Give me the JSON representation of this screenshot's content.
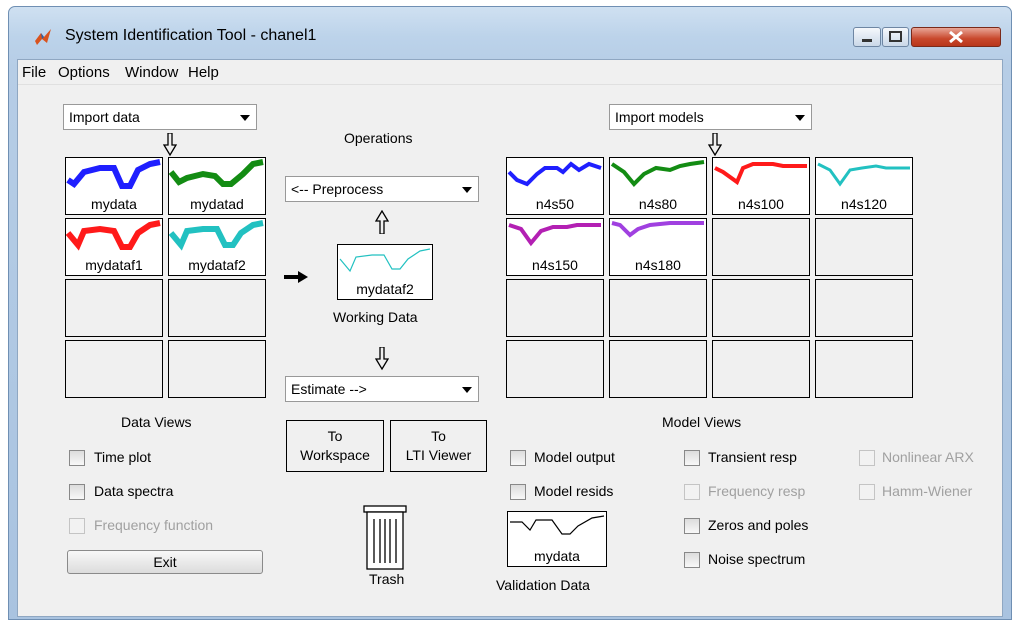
{
  "window": {
    "title": "System Identification Tool - chanel1"
  },
  "menu": [
    "File",
    "Options",
    "Window",
    "Help"
  ],
  "data_panel": {
    "import_dropdown": "Import data",
    "tiles": [
      {
        "label": "mydata",
        "color": "#1f1fff"
      },
      {
        "label": "mydatad",
        "color": "#138c13"
      },
      {
        "label": "mydataf1",
        "color": "#ff1a1a"
      },
      {
        "label": "mydataf2",
        "color": "#22c1c1"
      }
    ],
    "views_title": "Data Views",
    "checkboxes": [
      {
        "label": "Time plot",
        "enabled": true
      },
      {
        "label": "Data spectra",
        "enabled": true
      },
      {
        "label": "Frequency function",
        "enabled": false
      }
    ],
    "exit_label": "Exit"
  },
  "operations": {
    "title": "Operations",
    "preprocess": "<-- Preprocess",
    "working_data": {
      "label": "mydataf2",
      "caption": "Working Data",
      "color": "#22c1c1"
    },
    "estimate": "Estimate -->",
    "to_workspace": [
      "To",
      "Workspace"
    ],
    "to_lti": [
      "To",
      "LTI Viewer"
    ],
    "trash_label": "Trash",
    "validation": {
      "label": "mydata",
      "caption": "Validation Data"
    }
  },
  "model_panel": {
    "import_dropdown": "Import models",
    "tiles": [
      {
        "label": "n4s50",
        "color": "#1f1fff"
      },
      {
        "label": "n4s80",
        "color": "#138c13"
      },
      {
        "label": "n4s100",
        "color": "#ff1a1a"
      },
      {
        "label": "n4s120",
        "color": "#22c1c1"
      },
      {
        "label": "n4s150",
        "color": "#b320b3"
      },
      {
        "label": "n4s180",
        "color": "#a040e0"
      }
    ],
    "views_title": "Model Views",
    "checkboxes": [
      {
        "label": "Model output",
        "enabled": true
      },
      {
        "label": "Model resids",
        "enabled": true
      },
      {
        "label": "Transient resp",
        "enabled": true
      },
      {
        "label": "Frequency resp",
        "enabled": false
      },
      {
        "label": "Zeros and poles",
        "enabled": true
      },
      {
        "label": "Noise spectrum",
        "enabled": true
      },
      {
        "label": "Nonlinear ARX",
        "enabled": false
      },
      {
        "label": "Hamm-Wiener",
        "enabled": false
      }
    ]
  }
}
